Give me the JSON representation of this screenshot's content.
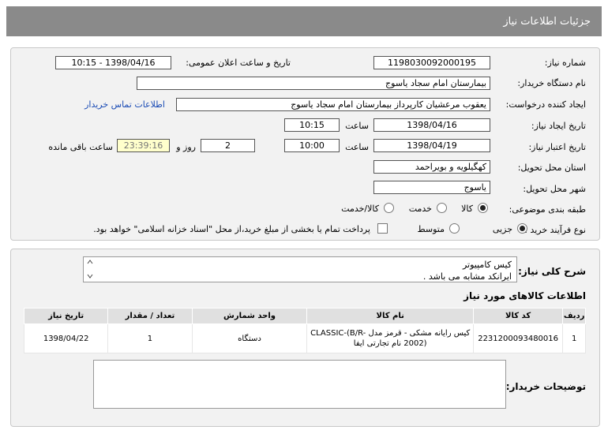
{
  "page_title": "جزئیات اطلاعات نیاز",
  "fields": {
    "need_number_label": "شماره نیاز:",
    "need_number": "1198030092000195",
    "announce_label": "تاریخ و ساعت اعلان عمومی:",
    "announce_value": "1398/04/16 - 10:15",
    "buyer_org_label": "نام دستگاه خریدار:",
    "buyer_org": "بیمارستان امام سجاد یاسوج",
    "creator_label": "ایجاد کننده درخواست:",
    "creator": "یعقوب مرعشیان کارپرداز بیمارستان امام سجاد یاسوج",
    "contact_link": "اطلاعات تماس خریدار",
    "created_date_label": "تاریخ ایجاد نیاز:",
    "created_date": "1398/04/16",
    "time_label": "ساعت",
    "created_time": "10:15",
    "valid_date_label": "تاریخ اعتبار نیاز:",
    "valid_date": "1398/04/19",
    "valid_time": "10:00",
    "days_value": "2",
    "days_label": "روز و",
    "remaining_time": "23:39:16",
    "remaining_label": "ساعت باقی مانده",
    "province_label": "استان محل تحویل:",
    "province": "کهگیلویه و بویراحمد",
    "city_label": "شهر محل تحویل:",
    "city": "یاسوج",
    "category_label": "طبقه بندی موضوعی:",
    "category_options": [
      "کالا",
      "خدمت",
      "کالا/خدمت"
    ],
    "process_label": "نوع فرآیند خرید :",
    "process_options": [
      "جزیی",
      "متوسط"
    ],
    "payment_note": "پرداخت تمام یا بخشی از مبلغ خرید،از محل \"اسناد خزانه اسلامی\" خواهد بود."
  },
  "summary": {
    "label": "شرح کلی نیاز:",
    "line1": "کیس کامپیوتر",
    "line2": "ایرانکد مشابه می باشد ."
  },
  "goods": {
    "section_title": "اطلاعات کالاهای مورد نیاز",
    "columns": [
      "ردیف",
      "کد کالا",
      "نام کالا",
      "واحد شمارش",
      "تعداد / مقدار",
      "تاریخ نیاز"
    ],
    "rows": [
      {
        "index": "1",
        "code": "2231200093480016",
        "name": "کیس رایانه مشکی - قرمز مدل CLASSIC-(B/R-2002) نام تجارتی ایفا",
        "unit": "دستگاه",
        "qty": "1",
        "date": "1398/04/22"
      }
    ]
  },
  "buyer_notes_label": "توضیحات خریدار:",
  "colors": {
    "title_bar": "#8a8a8a",
    "panel_bg": "#f2f2f2",
    "link": "#1a4bb5",
    "timer_bg": "#ffffcc"
  }
}
